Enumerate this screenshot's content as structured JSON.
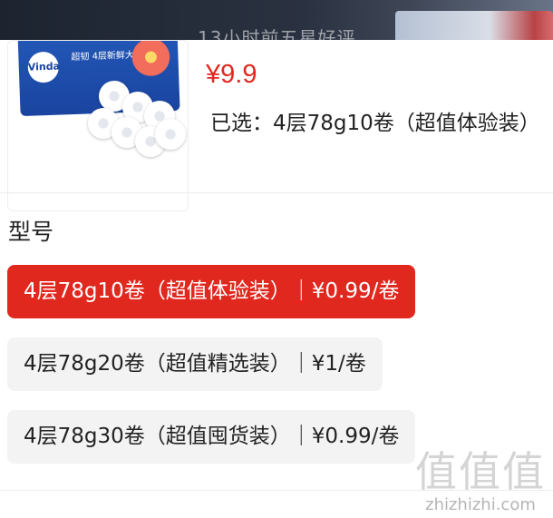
{
  "backdrop": {
    "ghost_text": "13小时前五星好评"
  },
  "product": {
    "thumbnail_brand": "Vinda",
    "thumbnail_tag": "超韧 4层新鲜大卷",
    "price": "¥9.9",
    "selected_label": "已选：",
    "selected_value": "4层78g10卷（超值体验装）"
  },
  "spec": {
    "title": "型号",
    "options": [
      {
        "label": "4层78g10卷（超值体验装）｜¥0.99/卷",
        "selected": true
      },
      {
        "label": "4层78g20卷（超值精选装）｜¥1/卷",
        "selected": false
      },
      {
        "label": "4层78g30卷（超值囤货装）｜¥0.99/卷",
        "selected": false
      }
    ]
  },
  "watermark": {
    "glyphs": "值值值",
    "url": "zhizhizhi.com"
  },
  "colors": {
    "accent": "#e0281f",
    "option_bg": "#f3f3f3"
  }
}
